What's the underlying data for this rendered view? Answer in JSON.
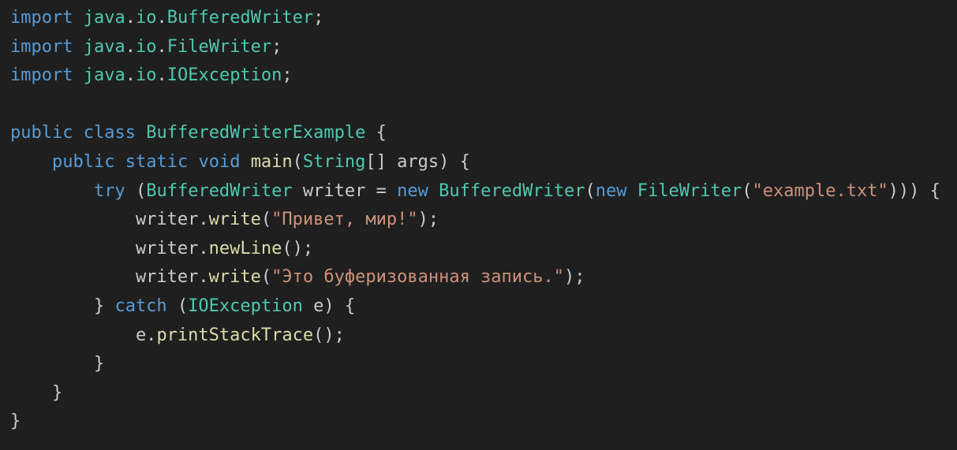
{
  "editor": {
    "language": "java",
    "colors": {
      "background": "#1f1f1f",
      "keyword": "#569cd6",
      "control": "#569cd6",
      "type": "#4ec9b0",
      "function": "#dcdcaa",
      "string": "#ce9178",
      "variable": "#9cdcfe",
      "plain": "#cccccc"
    },
    "lines": [
      [
        {
          "t": "import",
          "c": "keyword"
        },
        {
          "t": " ",
          "c": "plain"
        },
        {
          "t": "java",
          "c": "type"
        },
        {
          "t": ".",
          "c": "plain"
        },
        {
          "t": "io",
          "c": "type"
        },
        {
          "t": ".",
          "c": "plain"
        },
        {
          "t": "BufferedWriter",
          "c": "type"
        },
        {
          "t": ";",
          "c": "plain"
        }
      ],
      [
        {
          "t": "import",
          "c": "keyword"
        },
        {
          "t": " ",
          "c": "plain"
        },
        {
          "t": "java",
          "c": "type"
        },
        {
          "t": ".",
          "c": "plain"
        },
        {
          "t": "io",
          "c": "type"
        },
        {
          "t": ".",
          "c": "plain"
        },
        {
          "t": "FileWriter",
          "c": "type"
        },
        {
          "t": ";",
          "c": "plain"
        }
      ],
      [
        {
          "t": "import",
          "c": "keyword"
        },
        {
          "t": " ",
          "c": "plain"
        },
        {
          "t": "java",
          "c": "type"
        },
        {
          "t": ".",
          "c": "plain"
        },
        {
          "t": "io",
          "c": "type"
        },
        {
          "t": ".",
          "c": "plain"
        },
        {
          "t": "IOException",
          "c": "type"
        },
        {
          "t": ";",
          "c": "plain"
        }
      ],
      [],
      [
        {
          "t": "public",
          "c": "keyword"
        },
        {
          "t": " ",
          "c": "plain"
        },
        {
          "t": "class",
          "c": "keyword"
        },
        {
          "t": " ",
          "c": "plain"
        },
        {
          "t": "BufferedWriterExample",
          "c": "type"
        },
        {
          "t": " {",
          "c": "plain"
        }
      ],
      [
        {
          "t": "    ",
          "c": "plain"
        },
        {
          "t": "public",
          "c": "keyword"
        },
        {
          "t": " ",
          "c": "plain"
        },
        {
          "t": "static",
          "c": "keyword"
        },
        {
          "t": " ",
          "c": "plain"
        },
        {
          "t": "void",
          "c": "keyword"
        },
        {
          "t": " ",
          "c": "plain"
        },
        {
          "t": "main",
          "c": "function"
        },
        {
          "t": "(",
          "c": "plain"
        },
        {
          "t": "String",
          "c": "type"
        },
        {
          "t": "[] args) {",
          "c": "plain"
        }
      ],
      [
        {
          "t": "        ",
          "c": "plain"
        },
        {
          "t": "try",
          "c": "control"
        },
        {
          "t": " (",
          "c": "plain"
        },
        {
          "t": "BufferedWriter",
          "c": "type"
        },
        {
          "t": " writer = ",
          "c": "plain"
        },
        {
          "t": "new",
          "c": "keyword"
        },
        {
          "t": " ",
          "c": "plain"
        },
        {
          "t": "BufferedWriter",
          "c": "type"
        },
        {
          "t": "(",
          "c": "plain"
        },
        {
          "t": "new",
          "c": "keyword"
        },
        {
          "t": " ",
          "c": "plain"
        },
        {
          "t": "FileWriter",
          "c": "type"
        },
        {
          "t": "(",
          "c": "plain"
        },
        {
          "t": "\"example.txt\"",
          "c": "string"
        },
        {
          "t": "))) {",
          "c": "plain"
        }
      ],
      [
        {
          "t": "            writer.",
          "c": "plain"
        },
        {
          "t": "write",
          "c": "function"
        },
        {
          "t": "(",
          "c": "plain"
        },
        {
          "t": "\"Привет, мир!\"",
          "c": "string"
        },
        {
          "t": ");",
          "c": "plain"
        }
      ],
      [
        {
          "t": "            writer.",
          "c": "plain"
        },
        {
          "t": "newLine",
          "c": "function"
        },
        {
          "t": "();",
          "c": "plain"
        }
      ],
      [
        {
          "t": "            writer.",
          "c": "plain"
        },
        {
          "t": "write",
          "c": "function"
        },
        {
          "t": "(",
          "c": "plain"
        },
        {
          "t": "\"Это буферизованная запись.\"",
          "c": "string"
        },
        {
          "t": ");",
          "c": "plain"
        }
      ],
      [
        {
          "t": "        } ",
          "c": "plain"
        },
        {
          "t": "catch",
          "c": "control"
        },
        {
          "t": " (",
          "c": "plain"
        },
        {
          "t": "IOException",
          "c": "type"
        },
        {
          "t": " e) {",
          "c": "plain"
        }
      ],
      [
        {
          "t": "            e.",
          "c": "plain"
        },
        {
          "t": "printStackTrace",
          "c": "function"
        },
        {
          "t": "();",
          "c": "plain"
        }
      ],
      [
        {
          "t": "        }",
          "c": "plain"
        }
      ],
      [
        {
          "t": "    }",
          "c": "plain"
        }
      ],
      [
        {
          "t": "}",
          "c": "plain"
        }
      ]
    ]
  }
}
